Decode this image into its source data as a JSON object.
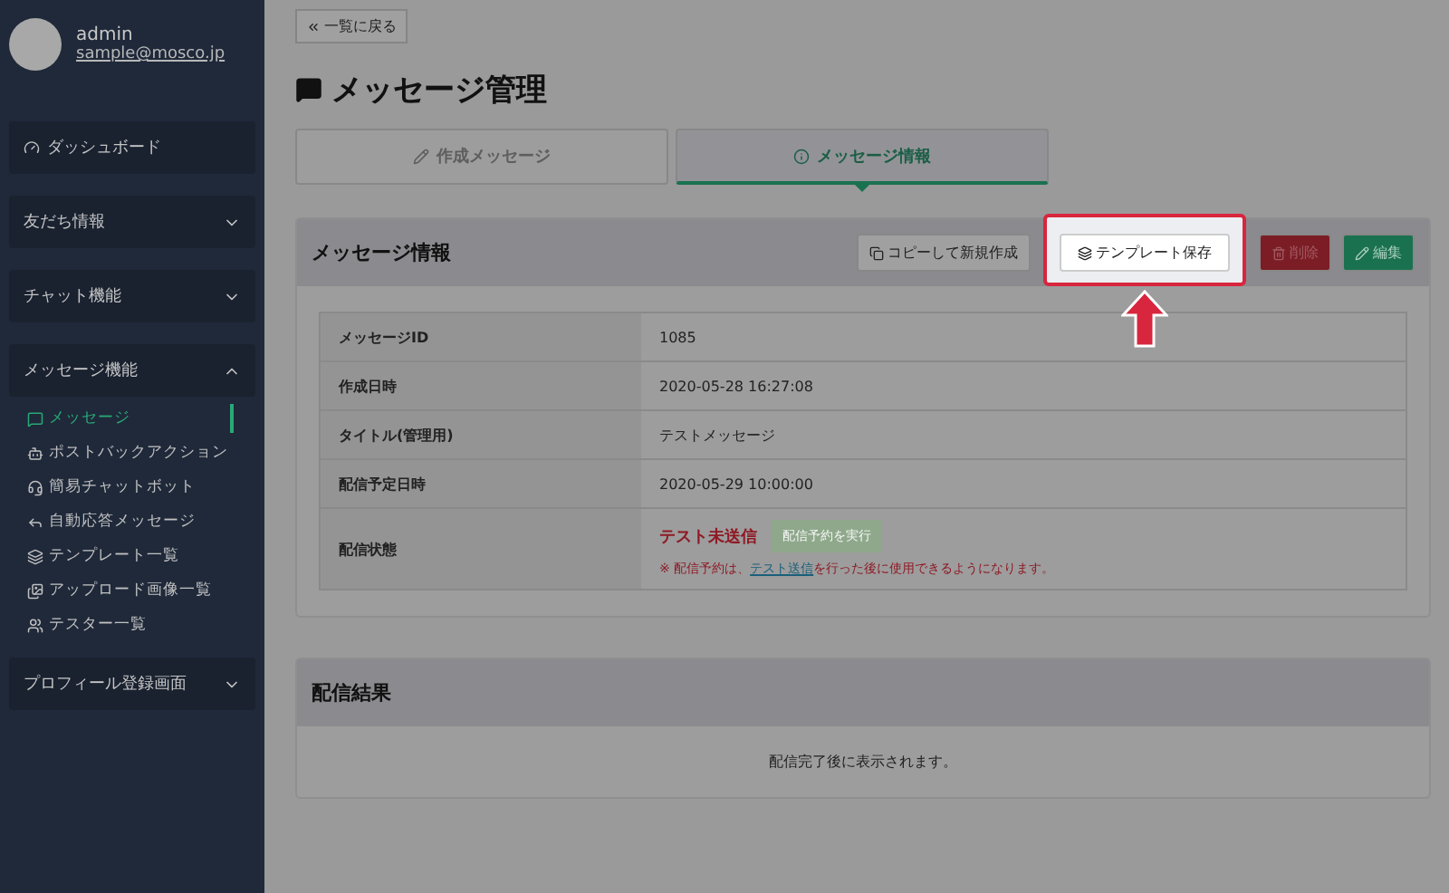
{
  "user": {
    "name": "admin",
    "email": "sample@mosco.jp"
  },
  "sidebar": {
    "items": [
      {
        "label": "ダッシュボード",
        "kind": "link"
      },
      {
        "label": "友だち情報",
        "kind": "group",
        "expanded": false
      },
      {
        "label": "チャット機能",
        "kind": "group",
        "expanded": false
      },
      {
        "label": "メッセージ機能",
        "kind": "group",
        "expanded": true,
        "children": [
          {
            "label": "メッセージ",
            "selected": true
          },
          {
            "label": "ポストバックアクション",
            "selected": false
          },
          {
            "label": "簡易チャットボット",
            "selected": false
          },
          {
            "label": "自動応答メッセージ",
            "selected": false
          },
          {
            "label": "テンプレート一覧",
            "selected": false
          },
          {
            "label": "アップロード画像一覧",
            "selected": false
          },
          {
            "label": "テスター一覧",
            "selected": false
          }
        ]
      },
      {
        "label": "プロフィール登録画面",
        "kind": "group",
        "expanded": false
      }
    ]
  },
  "back_button": "一覧に戻る",
  "page_title": "メッセージ管理",
  "tabs": [
    {
      "label": "作成メッセージ",
      "selected": false
    },
    {
      "label": "メッセージ情報",
      "selected": true
    }
  ],
  "info_panel": {
    "title": "メッセージ情報",
    "actions": [
      {
        "label": "コピーして新規作成",
        "kind": "copy",
        "highlighted": false
      },
      {
        "label": "テンプレート保存",
        "kind": "template",
        "highlighted": true
      },
      {
        "label": "削除",
        "kind": "danger",
        "highlighted": false
      },
      {
        "label": "編集",
        "kind": "primary",
        "highlighted": false
      }
    ],
    "rows": [
      {
        "label": "メッセージID",
        "value": "1085"
      },
      {
        "label": "作成日時",
        "value": "2020-05-28 16:27:08"
      },
      {
        "label": "タイトル(管理用)",
        "value": "テストメッセージ"
      },
      {
        "label": "配信予定日時",
        "value": "2020-05-29 10:00:00"
      }
    ],
    "status_row": {
      "label": "配信状態",
      "status": "テスト未送信",
      "button": {
        "label": "配信予約を実行",
        "disabled": true
      },
      "note_before": "※ 配信予約は、",
      "note_link": "テスト送信",
      "note_after": "を行った後に使用できるようになります。"
    }
  },
  "results_panel": {
    "title": "配信結果",
    "message": "配信完了後に表示されます。"
  }
}
